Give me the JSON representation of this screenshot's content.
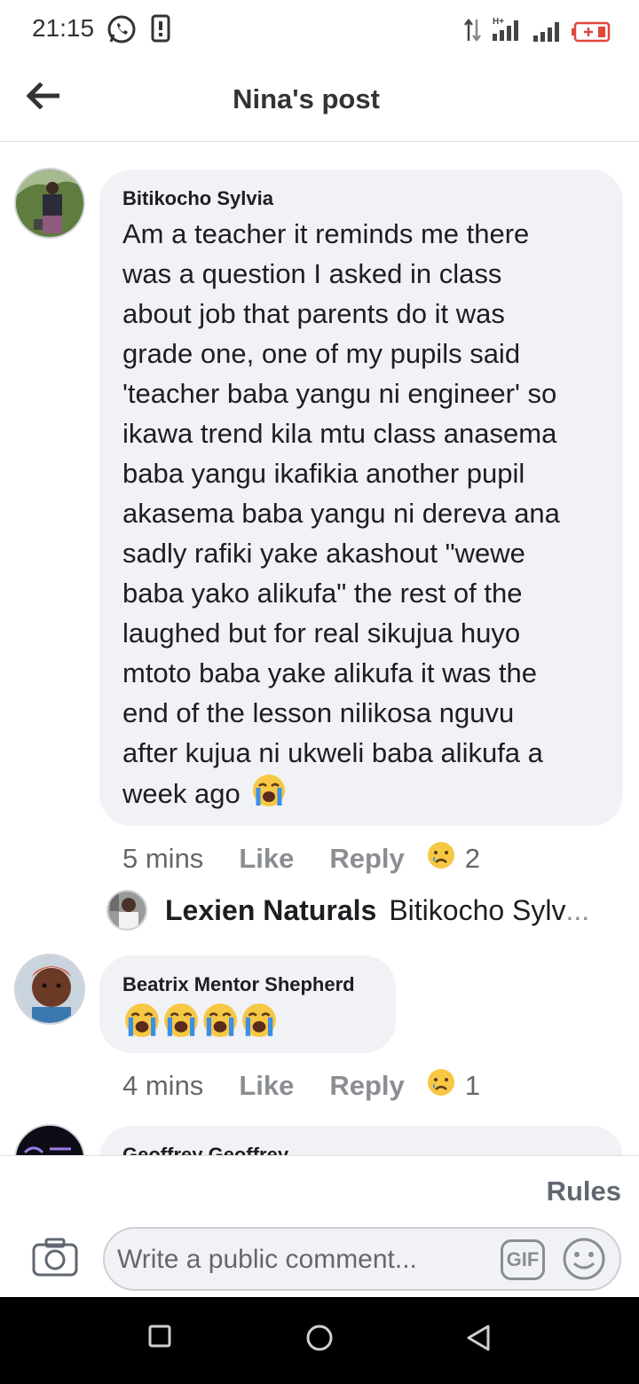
{
  "status_bar": {
    "time": "21:15",
    "icons": [
      "whatsapp-icon",
      "phone-storage-icon",
      "data-arrows-icon",
      "signal-h-plus-icon",
      "signal-icon",
      "battery-charging-icon"
    ]
  },
  "header": {
    "title": "Nina's post",
    "back_icon": "arrow-left-icon"
  },
  "comments": [
    {
      "author": "Bitikocho Sylvia",
      "text": "Am a teacher it reminds me there\nwas a question I asked in class\nabout job that parents do it was\ngrade one, one of my pupils said\n'teacher baba yangu ni engineer' so\nikawa trend kila mtu class anasema\nbaba yangu ikafikia another pupil\nakasema baba yangu ni dereva ana\nsadly rafiki yake akashout \"wewe\nbaba yako alikufa\" the rest of the\nlaughed but for real sikujua huyo\nmtoto baba yake alikufa it was the\nend of the lesson nilikosa nguvu\nafter kujua ni ukweli baba alikufa a\nweek ago",
      "time": "5 mins",
      "like_label": "Like",
      "reply_label": "Reply",
      "reaction_count": "2",
      "reaction": "sad-face"
    },
    {
      "author": "Beatrix Mentor Shepherd",
      "text": "",
      "time": "4 mins",
      "like_label": "Like",
      "reply_label": "Reply",
      "reaction_count": "1",
      "reaction": "sad-face"
    },
    {
      "author": "Geoffrey Geoffrey"
    }
  ],
  "reply_preview": {
    "author": "Lexien Naturals",
    "snippet": "Bitikocho Sylv",
    "ellipsis": "..."
  },
  "composer": {
    "rules_label": "Rules",
    "placeholder": "Write a public comment...",
    "gif_label": "GIF"
  },
  "colors": {
    "bubble": "#f0f2f5",
    "text": "#1c1e21",
    "secondary": "#65676b",
    "emoji_yellow": "#f7c844",
    "tear_blue": "#3b8fe6"
  }
}
